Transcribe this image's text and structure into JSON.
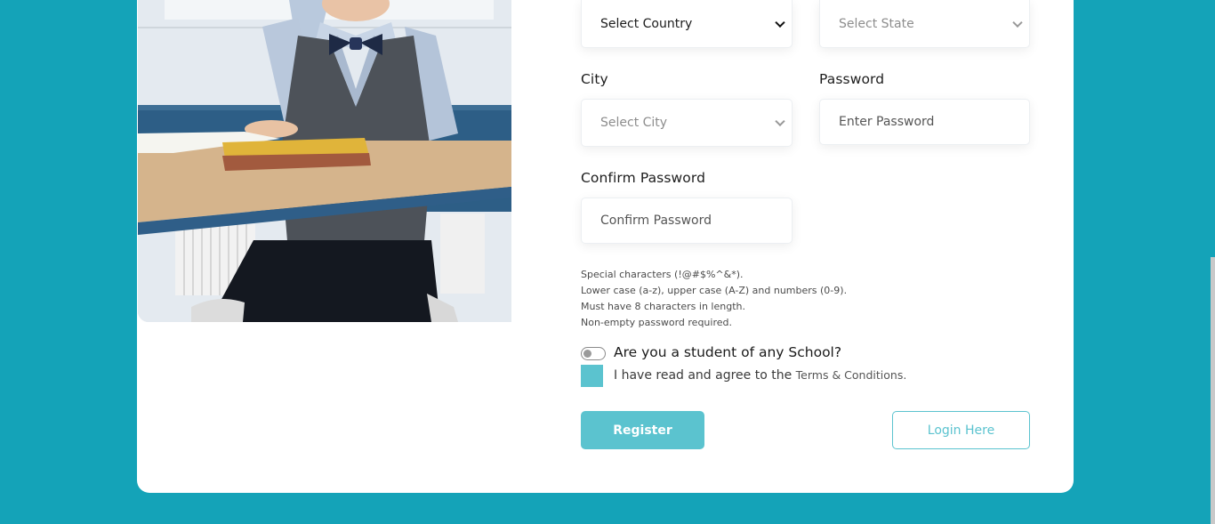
{
  "form": {
    "country_select": {
      "value": "Select Country"
    },
    "state_select": {
      "value": "Select State"
    },
    "city": {
      "label": "City",
      "value": "Select City"
    },
    "password": {
      "label": "Password",
      "placeholder": "Enter Password"
    },
    "confirm_password": {
      "label": "Confirm Password",
      "placeholder": "Confirm Password"
    },
    "password_rules": [
      "Special characters (!@#$%^&*).",
      "Lower case (a-z), upper case (A-Z) and numbers (0-9).",
      "Must have 8 characters in length.",
      "Non-empty password required."
    ],
    "student_toggle": {
      "label": "Are you a student of any School?",
      "checked": false
    },
    "agree": {
      "text": "I have read and agree to the",
      "link": "Terms & Conditions",
      "suffix": "."
    },
    "register_label": "Register",
    "login_label": "Login Here"
  },
  "colors": {
    "background": "#14a3b8",
    "accent": "#5bc3cf",
    "card": "#ffffff"
  }
}
